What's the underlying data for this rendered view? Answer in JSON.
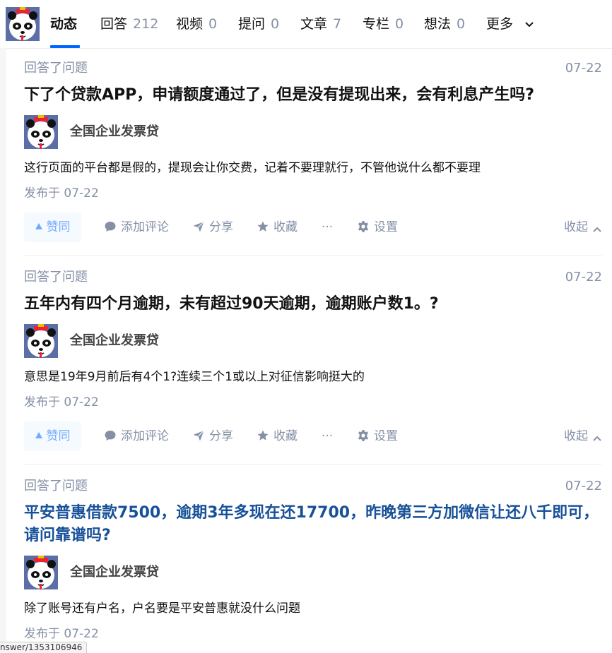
{
  "tabs": [
    {
      "label": "动态",
      "count": ""
    },
    {
      "label": "回答",
      "count": "212"
    },
    {
      "label": "视频",
      "count": "0"
    },
    {
      "label": "提问",
      "count": "0"
    },
    {
      "label": "文章",
      "count": "7"
    },
    {
      "label": "专栏",
      "count": "0"
    },
    {
      "label": "想法",
      "count": "0"
    },
    {
      "label": "更多",
      "count": ""
    }
  ],
  "items": [
    {
      "meta": "回答了问题",
      "date": "07-22",
      "title": "下了个贷款APP，申请额度通过了，但是没有提现出来，会有利息产生吗?",
      "author": "全国企业发票贷",
      "excerpt": "这行页面的平台都是假的，提现会让你交费，记着不要理就行，不管他说什么都不要理",
      "published": "发布于 07-22",
      "actions": {
        "vote": "赞同",
        "comment": "添加评论",
        "share": "分享",
        "favorite": "收藏",
        "more": "···",
        "settings": "设置",
        "collapse": "收起"
      }
    },
    {
      "meta": "回答了问题",
      "date": "07-22",
      "title": "五年内有四个月逾期，未有超过90天逾期，逾期账户数1。?",
      "author": "全国企业发票贷",
      "excerpt": "意思是19年9月前后有4个1?连续三个1或以上对征信影响挺大的",
      "published": "发布于 07-22",
      "actions": {
        "vote": "赞同",
        "comment": "添加评论",
        "share": "分享",
        "favorite": "收藏",
        "more": "···",
        "settings": "设置",
        "collapse": "收起"
      }
    },
    {
      "meta": "回答了问题",
      "date": "07-22",
      "title": "平安普惠借款7500，逾期3年多现在还17700，昨晚第三方加微信让还八千即可，请问靠谱吗?",
      "author": "全国企业发票贷",
      "excerpt": "除了账号还有户名，户名要是平安普惠就没什么问题",
      "published": "发布于 07-22"
    }
  ],
  "status_url": "nswer/1353106946",
  "colors": {
    "accent": "#0066ff",
    "muted": "#8590a6",
    "link_title": "#175199"
  }
}
